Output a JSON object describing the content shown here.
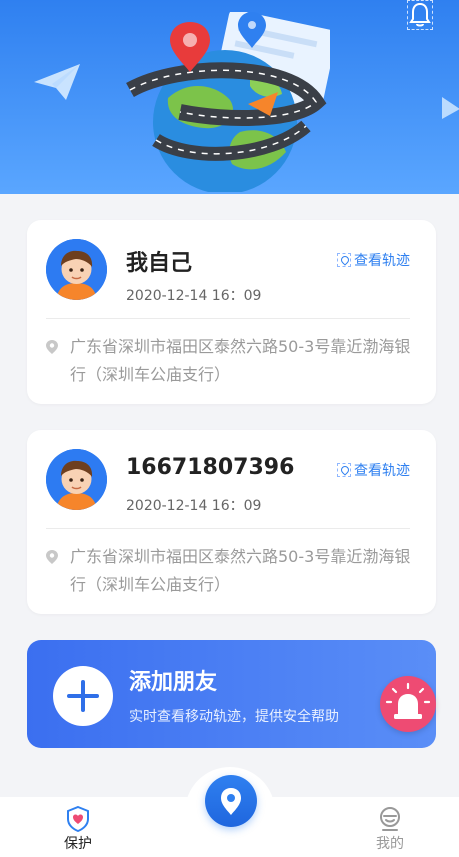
{
  "contacts": [
    {
      "name": "我自己",
      "time": "2020-12-14 16：09",
      "track_label": "查看轨迹",
      "address": "广东省深圳市福田区泰然六路50-3号靠近渤海银行（深圳车公庙支行）"
    },
    {
      "name": "16671807396",
      "time": "2020-12-14 16：09",
      "track_label": "查看轨迹",
      "address": "广东省深圳市福田区泰然六路50-3号靠近渤海银行（深圳车公庙支行）"
    }
  ],
  "add_friend": {
    "title": "添加朋友",
    "subtitle": "实时查看移动轨迹，提供安全帮助"
  },
  "tabs": [
    {
      "label": "保护",
      "icon": "shield-heart-icon",
      "active": true
    },
    {
      "label": "我的",
      "icon": "profile-icon",
      "active": false
    }
  ],
  "icons": {
    "header_bell": "bell-icon",
    "center": "location-pin-icon",
    "sos": "alarm-siren-icon"
  },
  "colors": {
    "primary": "#2f80f0",
    "sos": "#ee4b73",
    "avatar_bg": "#2d7bf2"
  }
}
